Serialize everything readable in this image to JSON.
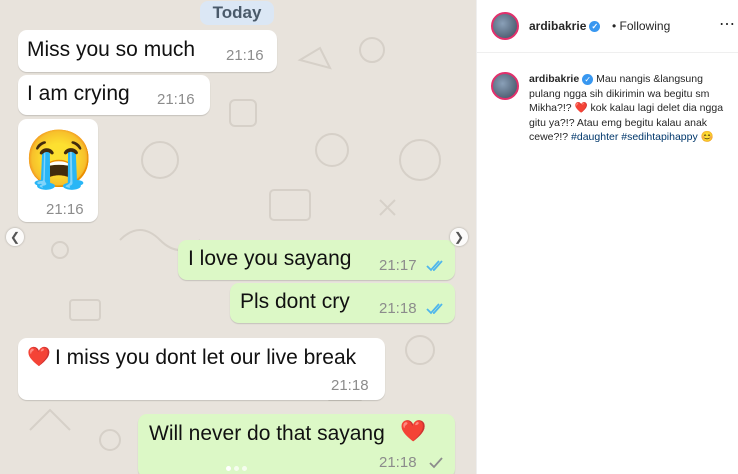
{
  "chat": {
    "date_label": "Today",
    "messages": [
      {
        "dir": "in",
        "text": "Miss you so much",
        "time": "21:16"
      },
      {
        "dir": "in",
        "text": "I am crying",
        "time": "21:16"
      },
      {
        "dir": "in",
        "text": "😭",
        "time": "21:16"
      },
      {
        "dir": "out",
        "text": "I love you sayang",
        "time": "21:17",
        "status": "read"
      },
      {
        "dir": "out",
        "text": "Pls dont cry",
        "time": "21:18",
        "status": "read"
      },
      {
        "dir": "in",
        "emoji": "❤️",
        "text": "I miss you dont let our live break",
        "time": "21:18"
      },
      {
        "dir": "out",
        "text": "Will never do that sayang",
        "emoji": "❤️",
        "time": "21:18",
        "status": "sent"
      }
    ],
    "colors": {
      "incoming": "#ffffff",
      "outgoing": "#dcf8c6",
      "read_tick": "#4fb6ec",
      "wallpaper": "#e8e3dc"
    }
  },
  "carousel": {
    "prev_icon": "chevron-left-icon",
    "next_icon": "chevron-right-icon",
    "pages": 3,
    "current": 1
  },
  "post": {
    "username": "ardibakrie",
    "follow_status": "Following",
    "separator": "•",
    "caption_parts": {
      "text1": "Mau nangis &langsung pulang ngga sih dikirimin wa begitu sm Mikha?!?",
      "heart": "❤️",
      "text2": "kok kalau lagi delet dia ngga gitu ya?!? Atau emg begitu kalau anak cewe?!?",
      "tag1": "#daughter",
      "tag2": "#sedihtapihappy",
      "emoji": "😊"
    },
    "more_icon": "ellipsis-icon",
    "verified_icon": "verified-badge-icon"
  }
}
